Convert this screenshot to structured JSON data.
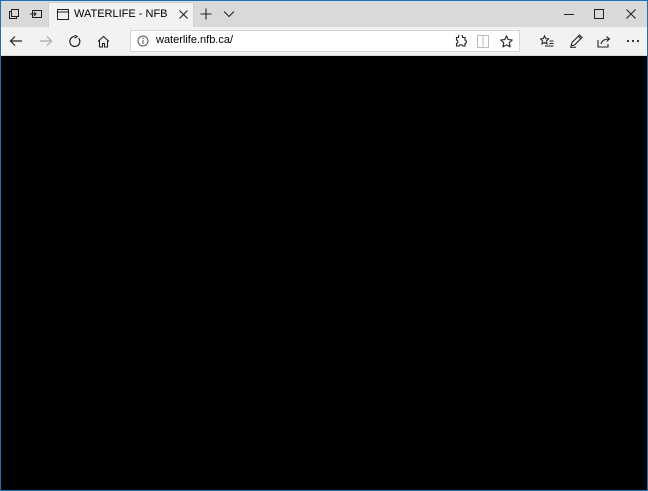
{
  "browser": {
    "tab": {
      "title": "WATERLIFE - NFB"
    },
    "address_bar": {
      "url": "waterlife.nfb.ca/"
    }
  },
  "icons": [
    "tab-manager-icon",
    "set-aside-tabs-icon",
    "page-icon",
    "close-tab-icon",
    "new-tab-icon",
    "tab-preview-icon",
    "minimize-icon",
    "maximize-icon",
    "close-window-icon",
    "back-icon",
    "forward-icon",
    "refresh-icon",
    "home-icon",
    "site-info-icon",
    "extension-icon",
    "reading-view-icon",
    "favorite-star-icon",
    "favorites-hub-icon",
    "notes-icon",
    "share-icon",
    "more-icon"
  ],
  "colors": {
    "window_border": "#1b6fb5",
    "titlebar": "#d9d9d9",
    "toolbar": "#f2f2f2",
    "content": "#000000"
  }
}
